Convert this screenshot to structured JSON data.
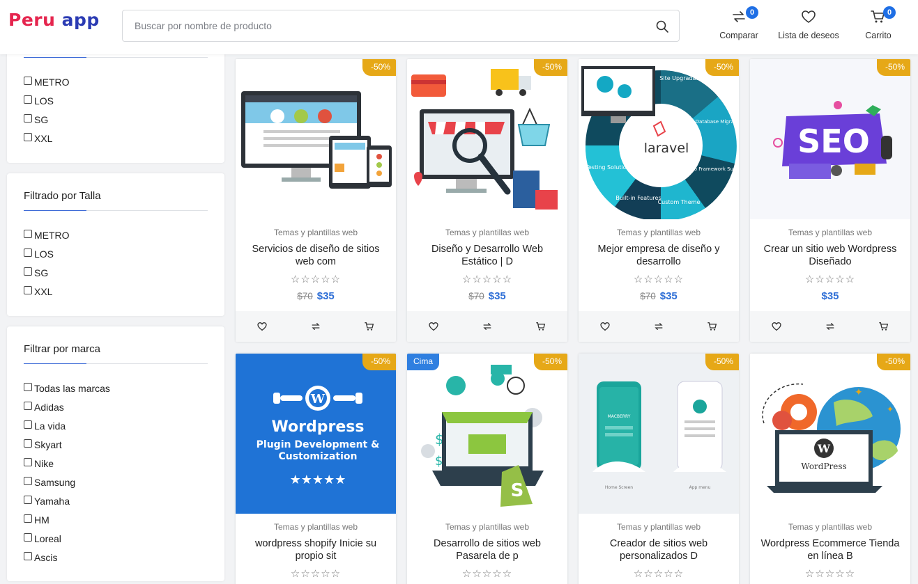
{
  "header": {
    "logo_part1": "Peru",
    "logo_part2": "app",
    "search_placeholder": "Buscar por nombre de producto",
    "compare": {
      "label": "Comparar",
      "count": "0"
    },
    "wishlist": {
      "label": "Lista de deseos"
    },
    "cart": {
      "label": "Carrito",
      "count": "0"
    }
  },
  "sidebar": {
    "panel_top_options": [
      "METRO",
      "LOS",
      "SG",
      "XXL"
    ],
    "size_filter": {
      "title": "Filtrado por Talla",
      "options": [
        "METRO",
        "LOS",
        "SG",
        "XXL"
      ]
    },
    "brand_filter": {
      "title": "Filtrar por marca",
      "options": [
        "Todas las marcas",
        "Adidas",
        "La vida",
        "Skyart",
        "Nike",
        "Samsung",
        "Yamaha",
        "HM",
        "Loreal",
        "Ascis"
      ]
    }
  },
  "products": [
    {
      "category": "Temas y plantillas web",
      "title": "Servicios de diseño de sitios web com",
      "stars": "☆☆☆☆☆",
      "old_price": "$70",
      "price": "$35",
      "tag": "-50%"
    },
    {
      "category": "Temas y plantillas web",
      "title": "Diseño y Desarrollo Web Estático | D",
      "stars": "☆☆☆☆☆",
      "old_price": "$70",
      "price": "$35",
      "tag": "-50%"
    },
    {
      "category": "Temas y plantillas web",
      "title": "Mejor empresa de diseño y desarrollo",
      "stars": "☆☆☆☆☆",
      "old_price": "$70",
      "price": "$35",
      "tag": "-50%",
      "image_texts": [
        "laravel",
        "Site Upgradation",
        "Database Migration",
        "Micro Framework Support",
        "Custom Theme",
        "Built-in Features",
        "Testing Solution"
      ]
    },
    {
      "category": "Temas y plantillas web",
      "title": "Crear un sitio web Wordpress Diseñado",
      "stars": "☆☆☆☆☆",
      "old_price": "",
      "price": "$35",
      "tag": "-50%",
      "image_texts": [
        "SEO"
      ]
    },
    {
      "category": "Temas y plantillas web",
      "title": "wordpress shopify Inicie su propio sit",
      "stars": "☆☆☆☆☆",
      "tag": "-50%",
      "image_texts": [
        "Wordpress",
        "Plugin Development &",
        "Customization"
      ]
    },
    {
      "category": "Temas y plantillas web",
      "title": "Desarrollo de sitios web Pasarela de p",
      "stars": "☆☆☆☆☆",
      "tag": "-50%",
      "tag_top": "Cima"
    },
    {
      "category": "Temas y plantillas web",
      "title": "Creador de sitios web personalizados D",
      "stars": "☆☆☆☆☆",
      "tag": "-50%",
      "image_texts": [
        "MACBERRY",
        "Home Screen",
        "App menu"
      ]
    },
    {
      "category": "Temas y plantillas web",
      "title": "Wordpress Ecommerce Tienda en línea B",
      "stars": "☆☆☆☆☆",
      "tag": "-50%",
      "image_texts": [
        "WordPress"
      ]
    }
  ],
  "icons": {
    "search": "search-icon",
    "compare": "compare-icon",
    "wishlist": "heart-icon",
    "cart": "cart-icon"
  },
  "colors": {
    "logo_red": "#e5254e",
    "logo_blue": "#2b3bb3",
    "accent": "#2f6fd6",
    "badge": "#1f6fe5",
    "tag": "#e6a817"
  }
}
